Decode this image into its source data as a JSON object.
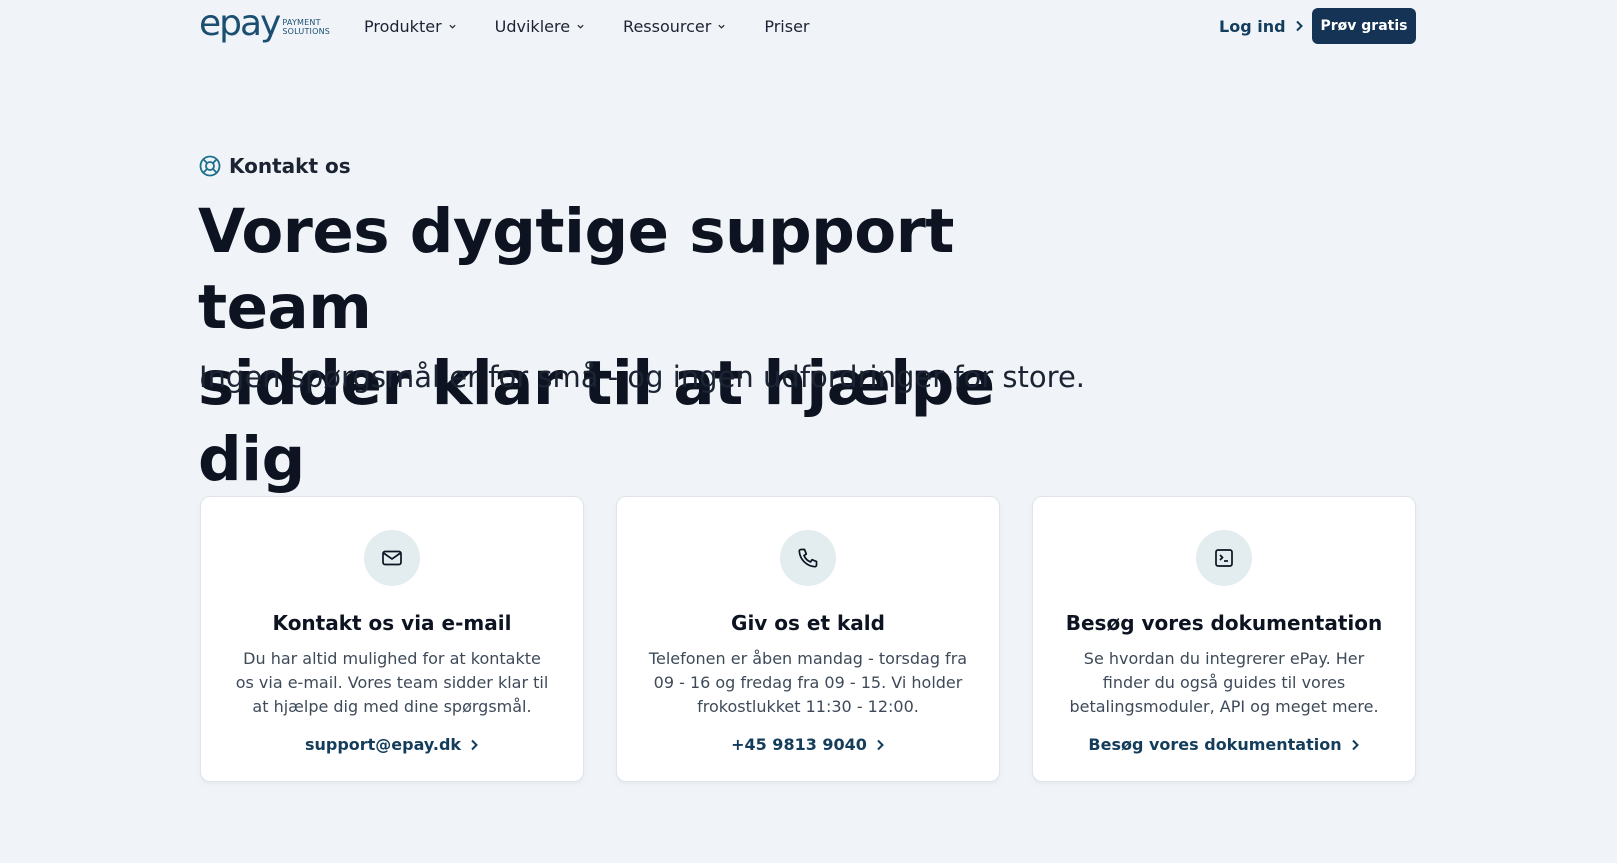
{
  "header": {
    "logo": {
      "word": "epay",
      "sub1": "PAYMENT",
      "sub2": "SOLUTIONS"
    },
    "menu": [
      {
        "label": "Produkter",
        "dropdown": true
      },
      {
        "label": "Udviklere",
        "dropdown": true
      },
      {
        "label": "Ressourcer",
        "dropdown": true
      },
      {
        "label": "Priser",
        "dropdown": false
      }
    ],
    "login_label": "Log ind",
    "cta_label": "Prøv gratis"
  },
  "hero": {
    "eyebrow": "Kontakt os",
    "headline_line1": "Vores dygtige support team",
    "headline_line2": "sidder klar til at hjælpe dig",
    "subhead": "Ingen spørgsmål er for små - og ingen udfordringer for store."
  },
  "cards": [
    {
      "icon": "mail-icon",
      "title": "Kontakt os via e-mail",
      "text": "Du har altid mulighed for at kontakte os via e-mail. Vores team sidder klar til at hjælpe dig med dine spørgsmål.",
      "link": "support@epay.dk"
    },
    {
      "icon": "phone-icon",
      "title": "Giv os et kald",
      "text": "Telefonen er åben mandag - torsdag fra 09 - 16 og fredag fra 09 - 15. Vi holder frokostlukket 11:30 - 12:00.",
      "link": "+45 9813 9040"
    },
    {
      "icon": "terminal-icon",
      "title": "Besøg vores dokumentation",
      "text": "Se hvordan du integrerer ePay. Her finder du også guides til vores betalingsmoduler, API og meget mere.",
      "link": "Besøg vores dokumentation"
    }
  ],
  "colors": {
    "background": "#f0f4f8",
    "brand": "#1b4f72",
    "cta": "#143355",
    "link": "#143d5c",
    "icon_bg": "#e3ecef"
  }
}
